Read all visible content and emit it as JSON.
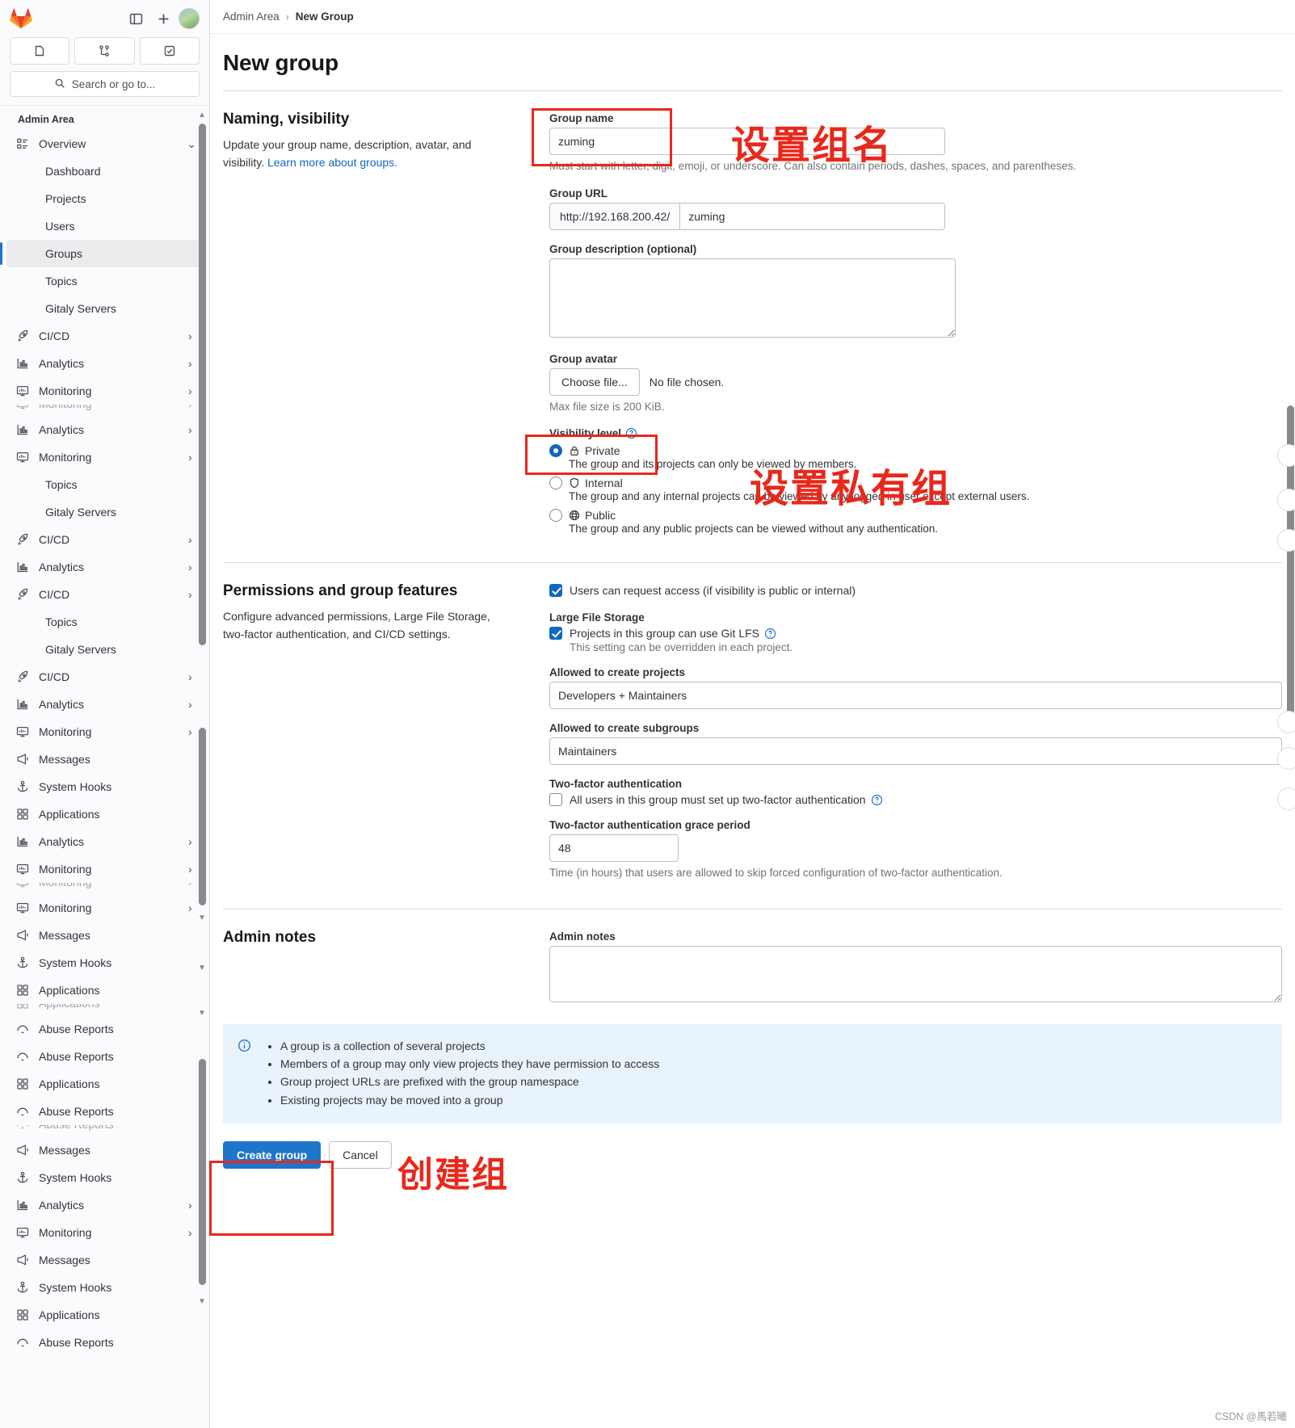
{
  "sidebar": {
    "search_placeholder": "Search or go to...",
    "section_title": "Admin Area",
    "quick_buttons": [
      "issues-icon",
      "merge-requests-icon",
      "todos-icon"
    ],
    "top_icons": [
      "sidebar-toggle-icon",
      "plus-icon",
      "user-avatar"
    ],
    "items": [
      {
        "label": "Overview",
        "icon": "overview-icon",
        "chevron": "⌄",
        "level": 0
      },
      {
        "label": "Dashboard",
        "icon": "",
        "chevron": "",
        "level": 1
      },
      {
        "label": "Projects",
        "icon": "",
        "chevron": "",
        "level": 1
      },
      {
        "label": "Users",
        "icon": "",
        "chevron": "",
        "level": 1
      },
      {
        "label": "Groups",
        "icon": "",
        "chevron": "",
        "level": 1,
        "active": true
      },
      {
        "label": "Topics",
        "icon": "",
        "chevron": "",
        "level": 1
      },
      {
        "label": "Gitaly Servers",
        "icon": "",
        "chevron": "",
        "level": 1
      },
      {
        "label": "CI/CD",
        "icon": "rocket-icon",
        "chevron": "›",
        "level": 0
      },
      {
        "label": "Analytics",
        "icon": "chart-icon",
        "chevron": "›",
        "level": 0
      },
      {
        "label": "Monitoring",
        "icon": "monitor-icon",
        "chevron": "›",
        "level": 0
      },
      {
        "label": "Analytics",
        "icon": "chart-icon",
        "chevron": "›",
        "level": 0
      },
      {
        "label": "Monitoring",
        "icon": "monitor-icon",
        "chevron": "›",
        "level": 0
      },
      {
        "label": "Topics",
        "icon": "",
        "chevron": "",
        "level": 1
      },
      {
        "label": "Gitaly Servers",
        "icon": "",
        "chevron": "",
        "level": 1
      },
      {
        "label": "CI/CD",
        "icon": "rocket-icon",
        "chevron": "›",
        "level": 0
      },
      {
        "label": "Analytics",
        "icon": "chart-icon",
        "chevron": "›",
        "level": 0
      },
      {
        "label": "CI/CD",
        "icon": "rocket-icon",
        "chevron": "›",
        "level": 0
      },
      {
        "label": "Topics",
        "icon": "",
        "chevron": "",
        "level": 1
      },
      {
        "label": "Gitaly Servers",
        "icon": "",
        "chevron": "",
        "level": 1
      },
      {
        "label": "CI/CD",
        "icon": "rocket-icon",
        "chevron": "›",
        "level": 0
      },
      {
        "label": "Analytics",
        "icon": "chart-icon",
        "chevron": "›",
        "level": 0
      },
      {
        "label": "Monitoring",
        "icon": "monitor-icon",
        "chevron": "›",
        "level": 0
      },
      {
        "label": "Messages",
        "icon": "megaphone-icon",
        "chevron": "",
        "level": 0
      },
      {
        "label": "System Hooks",
        "icon": "anchor-icon",
        "chevron": "",
        "level": 0
      },
      {
        "label": "Applications",
        "icon": "grid-icon",
        "chevron": "",
        "level": 0
      },
      {
        "label": "Analytics",
        "icon": "chart-icon",
        "chevron": "›",
        "level": 0
      },
      {
        "label": "Monitoring",
        "icon": "monitor-icon",
        "chevron": "›",
        "level": 0
      },
      {
        "label": "Monitoring",
        "icon": "monitor-icon",
        "chevron": "›",
        "level": 0
      },
      {
        "label": "Messages",
        "icon": "megaphone-icon",
        "chevron": "",
        "level": 0
      },
      {
        "label": "System Hooks",
        "icon": "anchor-icon",
        "chevron": "",
        "level": 0
      },
      {
        "label": "Applications",
        "icon": "grid-icon",
        "chevron": "",
        "level": 0
      },
      {
        "label": "Abuse Reports",
        "icon": "alert-icon",
        "chevron": "",
        "level": 0
      },
      {
        "label": "Abuse Reports",
        "icon": "alert-icon",
        "chevron": "",
        "level": 0
      },
      {
        "label": "Applications",
        "icon": "grid-icon",
        "chevron": "",
        "level": 0
      },
      {
        "label": "Abuse Reports",
        "icon": "alert-icon",
        "chevron": "",
        "level": 0
      },
      {
        "label": "Messages",
        "icon": "megaphone-icon",
        "chevron": "",
        "level": 0
      },
      {
        "label": "System Hooks",
        "icon": "anchor-icon",
        "chevron": "",
        "level": 0
      },
      {
        "label": "Analytics",
        "icon": "chart-icon",
        "chevron": "›",
        "level": 0
      },
      {
        "label": "Monitoring",
        "icon": "monitor-icon",
        "chevron": "›",
        "level": 0
      },
      {
        "label": "Messages",
        "icon": "megaphone-icon",
        "chevron": "",
        "level": 0
      },
      {
        "label": "System Hooks",
        "icon": "anchor-icon",
        "chevron": "",
        "level": 0
      },
      {
        "label": "Applications",
        "icon": "grid-icon",
        "chevron": "",
        "level": 0
      },
      {
        "label": "Abuse Reports",
        "icon": "alert-icon",
        "chevron": "",
        "level": 0
      }
    ]
  },
  "breadcrumb": {
    "root": "Admin Area",
    "separator": "›",
    "current": "New Group"
  },
  "page": {
    "title": "New group"
  },
  "naming": {
    "heading": "Naming, visibility",
    "description": "Update your group name, description, avatar, and visibility.",
    "learn_more": "Learn more about groups.",
    "group_name_label": "Group name",
    "group_name_value": "zuming",
    "group_name_placeholder": "",
    "group_name_help": "Must start with letter, digit, emoji, or underscore. Can also contain periods, dashes, spaces, and parentheses.",
    "group_url_label": "Group URL",
    "group_url_prefix": "http://192.168.200.42/",
    "group_url_value": "zuming",
    "group_description_label": "Group description (optional)",
    "group_description_value": "",
    "group_avatar_label": "Group avatar",
    "choose_file_label": "Choose file...",
    "no_file_chosen": "No file chosen.",
    "max_file_size": "Max file size is 200 KiB.",
    "visibility_label": "Visibility level",
    "visibility_options": [
      {
        "value": "private",
        "label": "Private",
        "icon": "lock-icon",
        "selected": true,
        "description": "The group and its projects can only be viewed by members."
      },
      {
        "value": "internal",
        "label": "Internal",
        "icon": "shield-icon",
        "selected": false,
        "description": "The group and any internal projects can be viewed by any logged in user except external users."
      },
      {
        "value": "public",
        "label": "Public",
        "icon": "globe-icon",
        "selected": false,
        "description": "The group and any public projects can be viewed without any authentication."
      }
    ]
  },
  "permissions": {
    "heading": "Permissions and group features",
    "description": "Configure advanced permissions, Large File Storage, two-factor authentication, and CI/CD settings.",
    "request_access_label": "Users can request access (if visibility is public or internal)",
    "request_access_checked": true,
    "lfs_heading": "Large File Storage",
    "lfs_label": "Projects in this group can use Git LFS",
    "lfs_checked": true,
    "lfs_help": "This setting can be overridden in each project.",
    "create_projects_label": "Allowed to create projects",
    "create_projects_value": "Developers + Maintainers",
    "create_subgroups_label": "Allowed to create subgroups",
    "create_subgroups_value": "Maintainers",
    "two_factor_heading": "Two-factor authentication",
    "two_factor_label": "All users in this group must set up two-factor authentication",
    "two_factor_checked": false,
    "grace_period_label": "Two-factor authentication grace period",
    "grace_period_value": "48",
    "grace_period_help": "Time (in hours) that users are allowed to skip forced configuration of two-factor authentication."
  },
  "admin_notes": {
    "heading": "Admin notes",
    "field_label": "Admin notes",
    "value": ""
  },
  "info_alert": {
    "icon": "info-icon",
    "items": [
      "A group is a collection of several projects",
      "Members of a group may only view projects they have permission to access",
      "Group project URLs are prefixed with the group namespace",
      "Existing projects may be moved into a group"
    ]
  },
  "actions": {
    "create_label": "Create group",
    "cancel_label": "Cancel"
  },
  "annotations": {
    "group_name": "设置组名",
    "private_group": "设置私有组",
    "create_group": "创建组",
    "color": "#e8281b"
  },
  "watermark": "CSDN @馬若曦"
}
